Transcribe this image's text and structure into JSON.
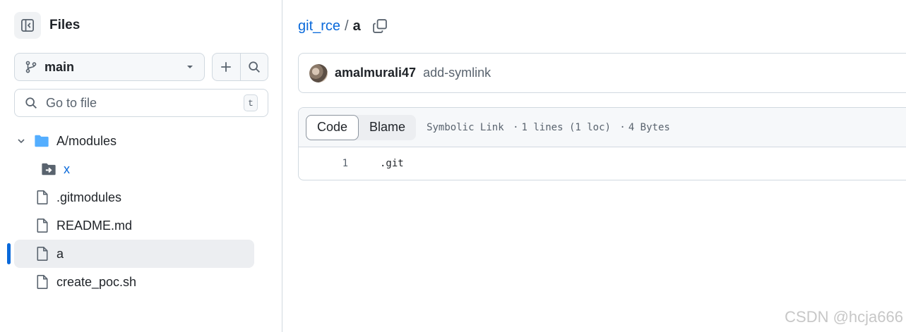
{
  "sidebar": {
    "title": "Files",
    "branch": "main",
    "search": {
      "placeholder": "Go to file",
      "shortcut": "t"
    },
    "tree": [
      {
        "label": "A/modules",
        "type": "folder",
        "expanded": true
      },
      {
        "label": "x",
        "type": "submodule"
      },
      {
        "label": ".gitmodules",
        "type": "file"
      },
      {
        "label": "README.md",
        "type": "file"
      },
      {
        "label": "a",
        "type": "file",
        "active": true
      },
      {
        "label": "create_poc.sh",
        "type": "file"
      }
    ]
  },
  "breadcrumb": {
    "repo": "git_rce",
    "separator": "/",
    "file": "a"
  },
  "commit": {
    "author": "amalmurali47",
    "message": "add-symlink"
  },
  "file_view": {
    "tabs": [
      "Code",
      "Blame"
    ],
    "selected_tab": "Code",
    "meta": {
      "kind": "Symbolic Link",
      "lines": "1 lines (1 loc)",
      "size": "4 Bytes"
    },
    "lines": [
      {
        "number": "1",
        "code": ".git"
      }
    ]
  },
  "watermark": "CSDN @hcja666",
  "colors": {
    "accent": "#0969da",
    "folder": "#54aeff",
    "border": "#d1d9e0",
    "muted": "#59636e"
  }
}
